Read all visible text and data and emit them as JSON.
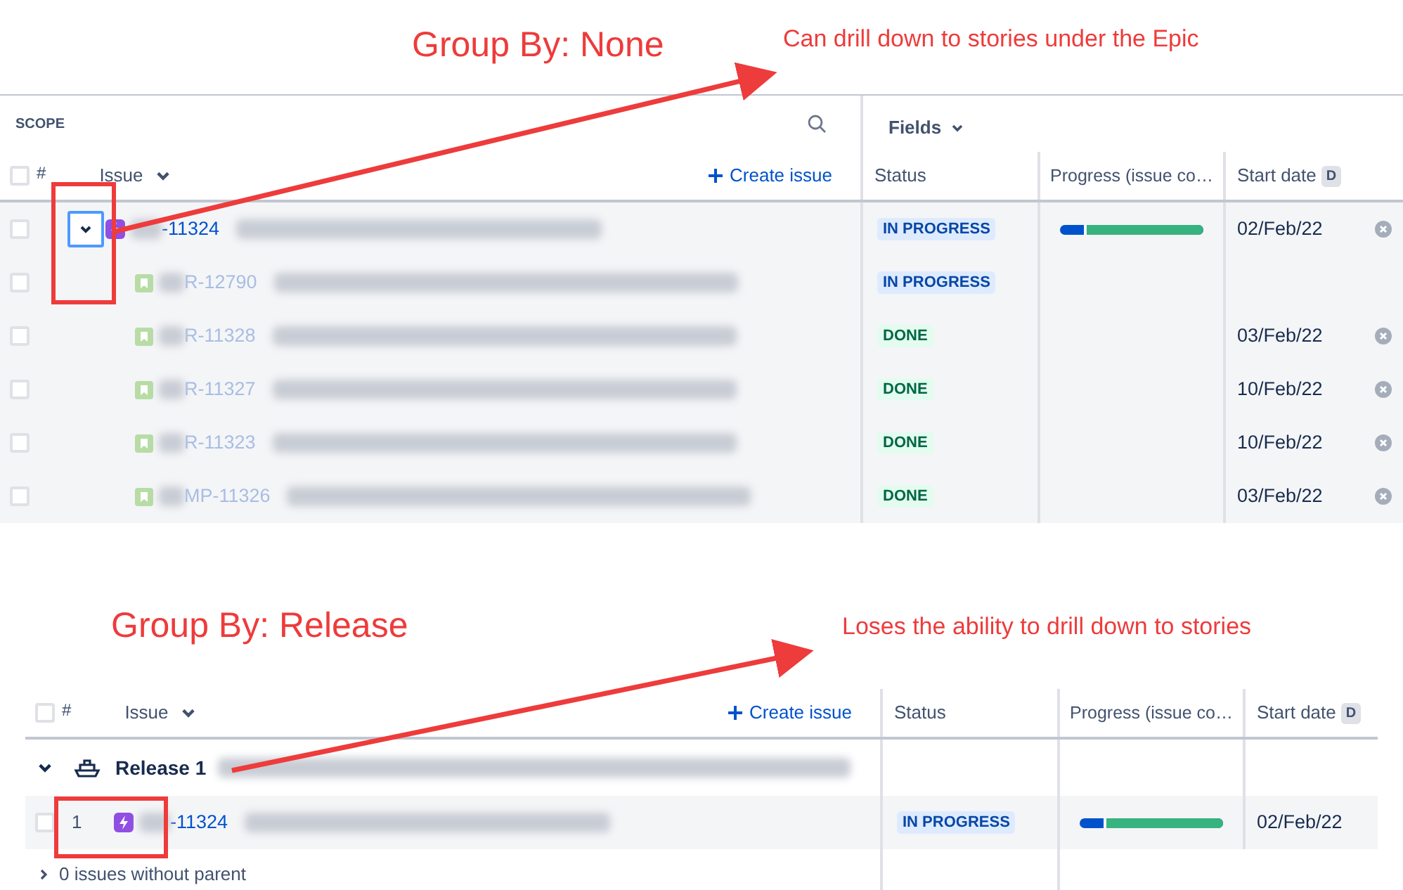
{
  "annotations": [
    {
      "kind": "heading",
      "text": "Group By: None"
    },
    {
      "kind": "note",
      "text": "Can drill down to stories under the Epic"
    },
    {
      "kind": "heading",
      "text": "Group By: Release"
    },
    {
      "kind": "note",
      "text": "Loses the ability to drill down to stories"
    }
  ],
  "top_panel": {
    "scope_label": "SCOPE",
    "fields_button": "Fields",
    "columns": {
      "number": "#",
      "issue": "Issue",
      "create": "Create issue",
      "status": "Status",
      "progress": "Progress (issue co…",
      "start_date": "Start date",
      "start_date_badge": "D"
    },
    "select_all_checked": false,
    "rows": [
      {
        "kind": "epic",
        "checked": false,
        "expanded": true,
        "key": "-11324",
        "status": "IN PROGRESS",
        "color": "#0747a6",
        "level": 0.83,
        "start_date": "02/Feb/22"
      },
      {
        "kind": "story",
        "checked": false,
        "key": "R-12790",
        "status": "IN PROGRESS",
        "color": "#0747a6"
      },
      {
        "kind": "story",
        "checked": false,
        "key": "R-11328",
        "status": "DONE",
        "color": "#006644",
        "start_date": "03/Feb/22"
      },
      {
        "kind": "story",
        "checked": false,
        "key": "R-11327",
        "status": "DONE",
        "color": "#006644",
        "start_date": "10/Feb/22"
      },
      {
        "kind": "story",
        "checked": false,
        "key": "R-11323",
        "status": "DONE",
        "color": "#006644",
        "start_date": "10/Feb/22"
      },
      {
        "kind": "story",
        "checked": false,
        "key": "MP-11326",
        "status": "DONE",
        "color": "#006644",
        "start_date": "03/Feb/22"
      }
    ]
  },
  "bottom_panel": {
    "columns": {
      "number": "#",
      "issue": "Issue",
      "create": "Create issue",
      "status": "Status",
      "progress": "Progress (issue co…",
      "start_date": "Start date",
      "start_date_badge": "D"
    },
    "select_all_checked": false,
    "group": {
      "label": "Release 1",
      "expanded": true
    },
    "rows": [
      {
        "kind": "epic",
        "checked": false,
        "number": "1",
        "key": "-11324",
        "status": "IN PROGRESS",
        "color": "#0747a6",
        "level": 0.83,
        "start_date": "02/Feb/22"
      }
    ],
    "footer": "0 issues without parent"
  }
}
